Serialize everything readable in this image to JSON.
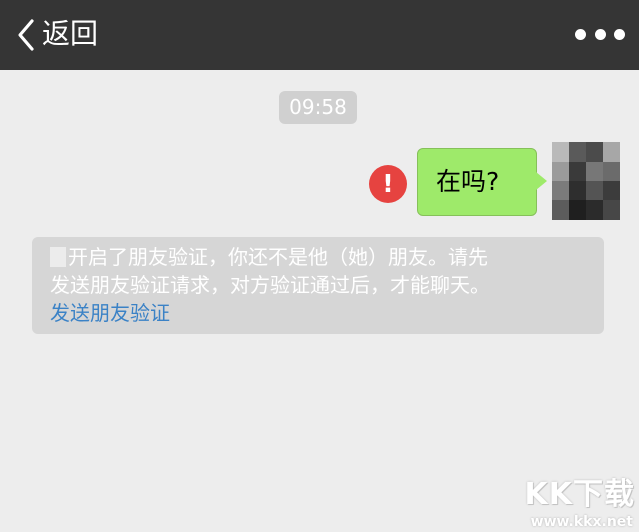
{
  "nav": {
    "back_label": "返回",
    "back_icon": "chevron-left-icon",
    "more_icon": "more-dots-icon"
  },
  "chat": {
    "timestamp": "09:58",
    "outgoing_message": "在吗?",
    "send_failed_icon": "error-exclamation-icon",
    "send_failed_mark": "!",
    "system_notice": {
      "line1": "开启了朋友验证，你还不是他（她）朋友。请先",
      "line2": "发送朋友验证请求，对方验证通过后，才能聊天。",
      "link": "发送朋友验证"
    }
  },
  "watermark": {
    "logo": "KK下载",
    "url": "www.kkx.net"
  },
  "colors": {
    "nav_bg": "#353535",
    "chat_bg": "#ededed",
    "bubble_green": "#9eea6a",
    "error_red": "#e64340",
    "link_blue": "#3b82c6"
  }
}
